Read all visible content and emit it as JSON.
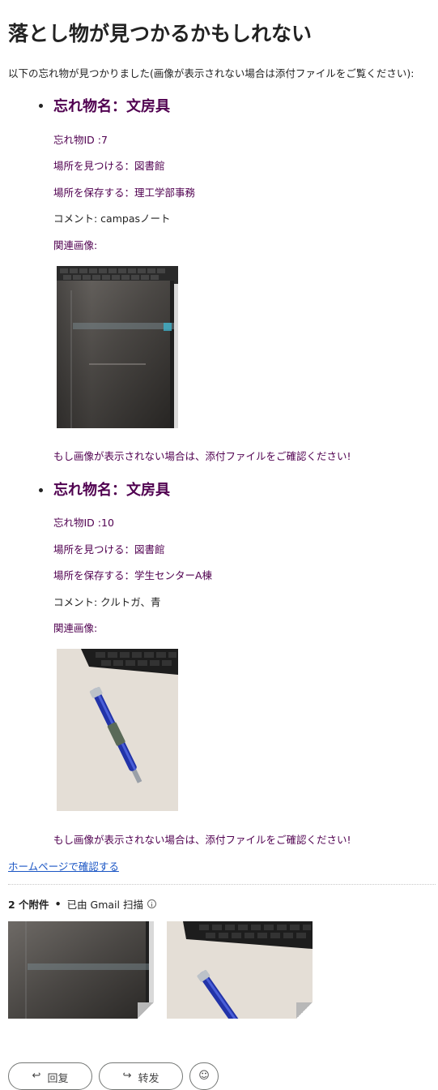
{
  "heading": "落とし物が見つかるかもしれない",
  "intro": "以下の忘れ物が見つかりました(画像が表示されない場合は添付ファイルをご覧ください):",
  "items": [
    {
      "title": "忘れ物名：文房具",
      "id_line": "忘れ物ID :7",
      "found_line": "場所を見つける：図書館",
      "stored_line": "場所を保存する：理工学部事務",
      "comment_line": "コメント: campasノート",
      "image_label": "関連画像:",
      "image_subject": "notebook-photo",
      "notice": "もし画像が表示されない場合は、添付ファイルをご確認ください!"
    },
    {
      "title": "忘れ物名：文房具",
      "id_line": "忘れ物ID :10",
      "found_line": "場所を見つける：図書館",
      "stored_line": "場所を保存する：学生センターA棟",
      "comment_line": "コメント: クルトガ、青",
      "image_label": "関連画像:",
      "image_subject": "pen-photo",
      "notice": "もし画像が表示されない場合は、添付ファイルをご確認ください!"
    }
  ],
  "home_link": "ホームページで確認する",
  "attachments": {
    "count_label": "2 个附件",
    "separator": "•",
    "scan_label": "已由 Gmail 扫描",
    "thumbnails": [
      "notebook-photo",
      "pen-photo"
    ]
  },
  "actions": {
    "reply_label": "回复",
    "forward_label": "转发"
  },
  "colors": {
    "quoted_text": "#500050",
    "link": "#1a55c4",
    "body_text": "#222222"
  }
}
